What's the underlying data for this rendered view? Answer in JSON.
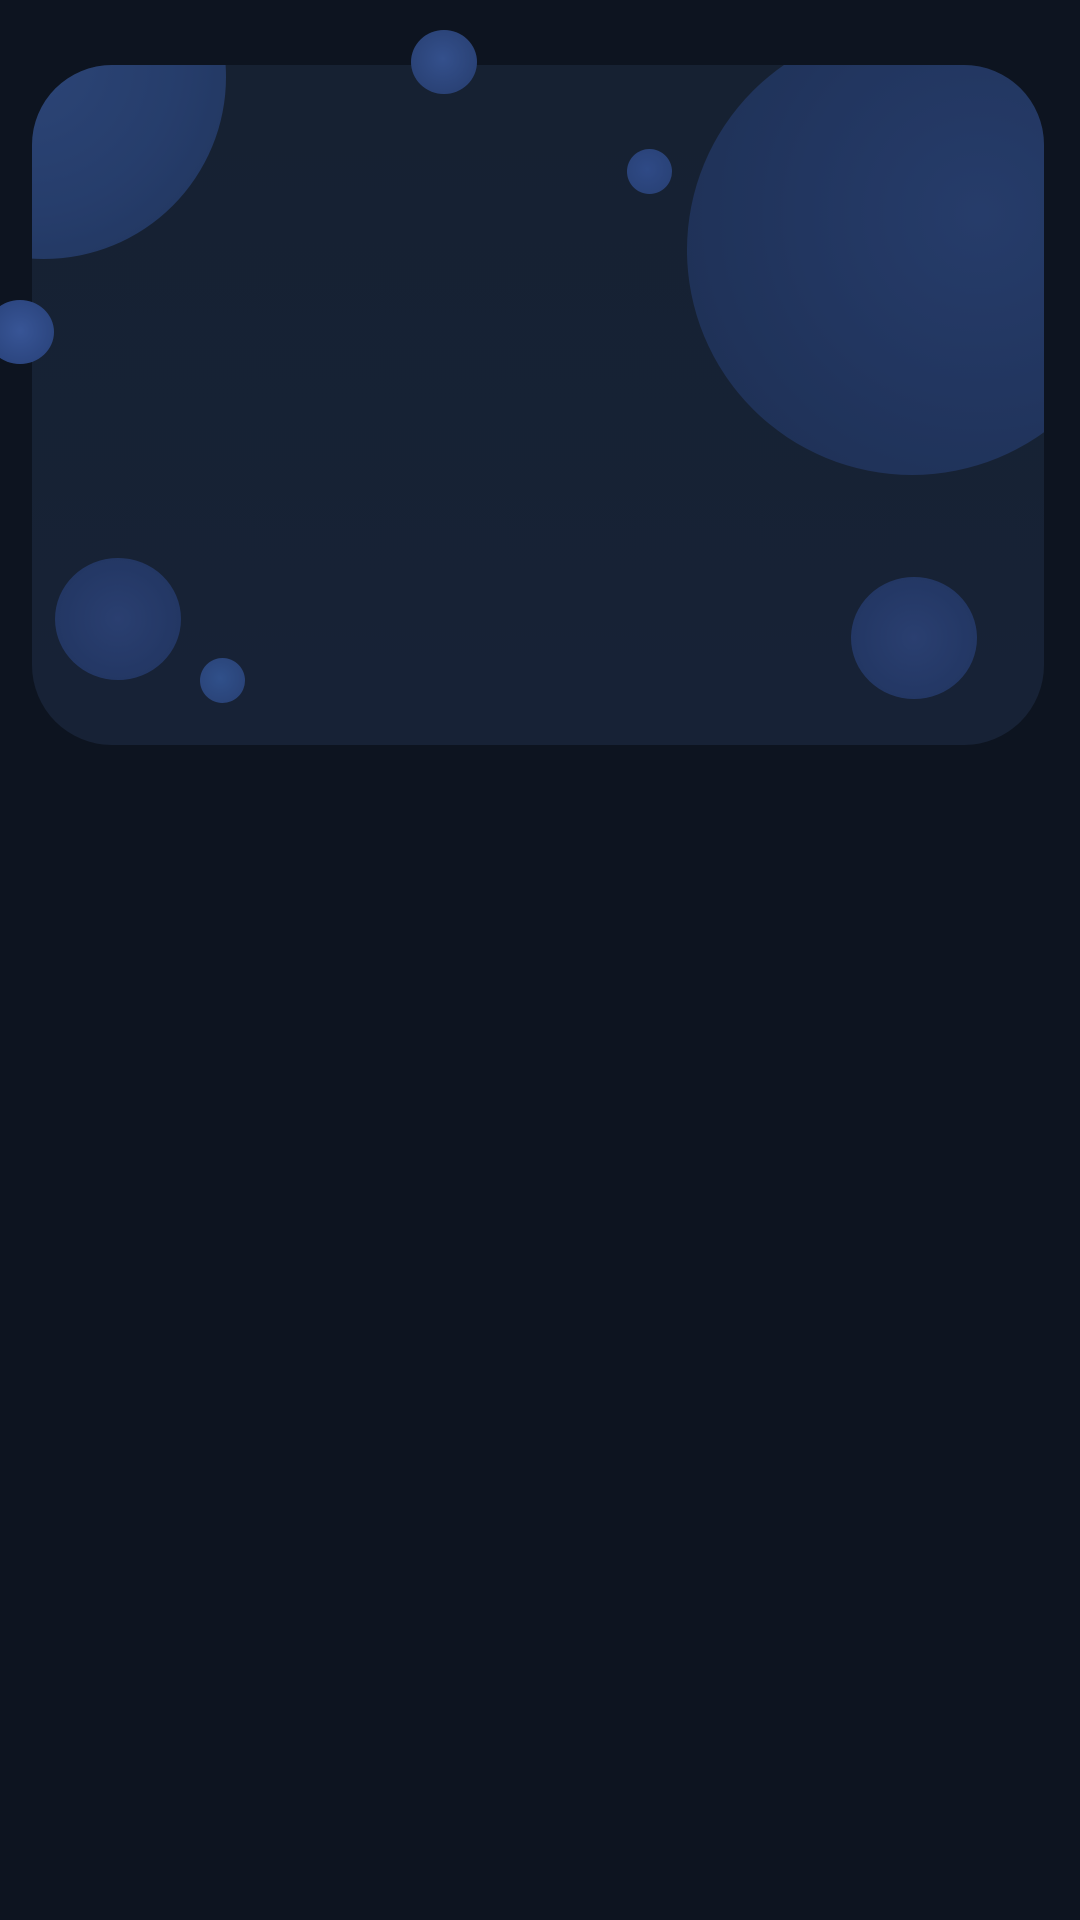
{
  "screen": {
    "background_color": "#0d1420",
    "card_color": "#172236",
    "bubble_color": "#2a4276"
  },
  "hero_card": {
    "decoration_icons": [
      "bubble",
      "bubble",
      "bubble",
      "bubble",
      "bubble",
      "bubble",
      "bubble",
      "bubble"
    ]
  }
}
